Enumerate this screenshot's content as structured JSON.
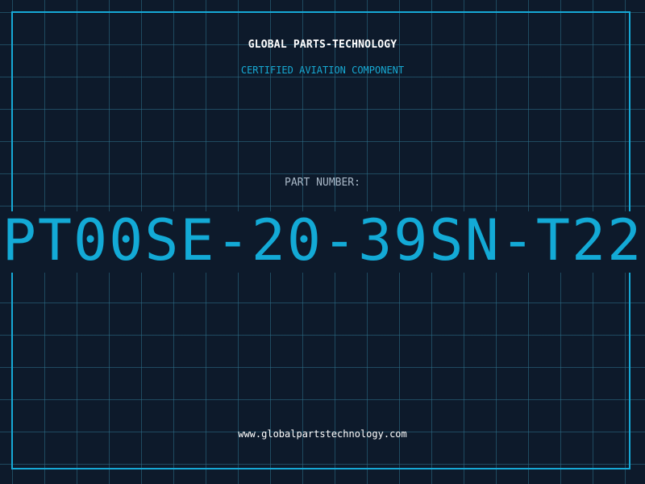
{
  "header": {
    "company": "GLOBAL PARTS-TECHNOLOGY",
    "subtitle": "CERTIFIED AVIATION COMPONENT"
  },
  "part": {
    "label": "PART NUMBER:",
    "number": "PT00SE-20-39SN-T22"
  },
  "footer": {
    "website": "www.globalpartstechnology.com"
  },
  "colors": {
    "background": "#0d1a2b",
    "accent": "#13aad6",
    "grid": "#2e708c",
    "text": "#ffffff"
  }
}
